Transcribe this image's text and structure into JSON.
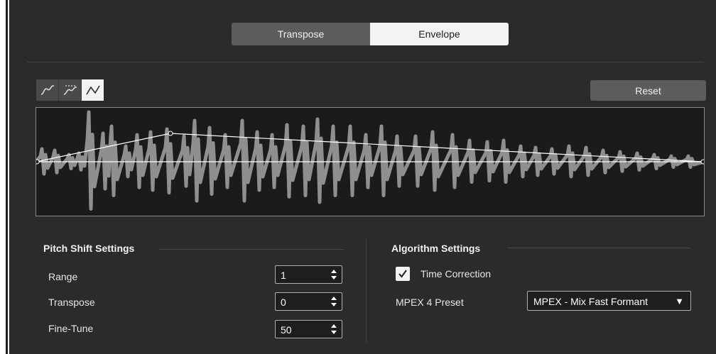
{
  "tabs": [
    {
      "label": "Transpose",
      "active": false
    },
    {
      "label": "Envelope",
      "active": true
    }
  ],
  "curve_modes": [
    {
      "icon": "spline-curve-icon",
      "selected": false
    },
    {
      "icon": "damped-spline-curve-icon",
      "selected": false
    },
    {
      "icon": "linear-curve-icon",
      "selected": true
    }
  ],
  "reset_label": "Reset",
  "pitch_shift": {
    "title": "Pitch Shift Settings",
    "range_label": "Range",
    "range_value": "1",
    "transpose_label": "Transpose",
    "transpose_value": "0",
    "finetune_label": "Fine-Tune",
    "finetune_value": "50"
  },
  "algorithm": {
    "title": "Algorithm Settings",
    "time_correction_label": "Time Correction",
    "time_correction_checked": true,
    "preset_label": "MPEX 4 Preset",
    "preset_value": "MPEX - Mix Fast Formant",
    "preset_caret": "▼"
  },
  "colors": {
    "background": "#2b2b2b",
    "waveform": "#8f8f8f",
    "envelope": "#ffffff",
    "active_tab": "#f3f3f3"
  }
}
